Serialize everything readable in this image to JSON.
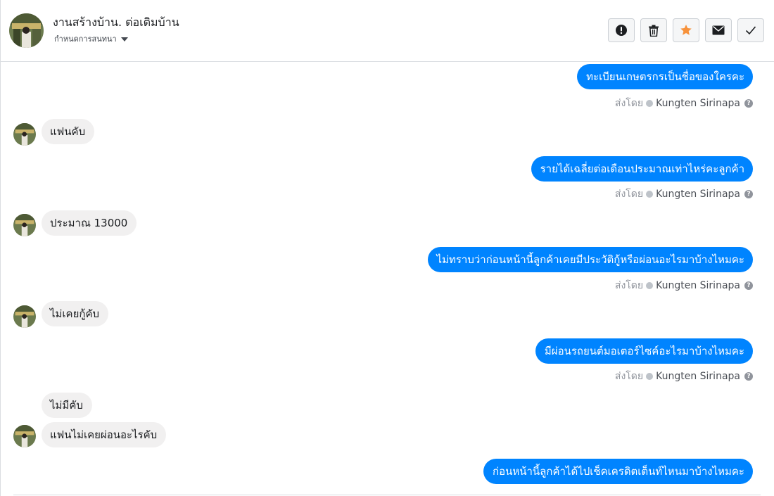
{
  "header": {
    "title": "งานสร้างบ้าน. ต่อเติมบ้าน",
    "subtitle": "กำหนดการสนทนา",
    "actions": [
      {
        "icon": "alert-icon",
        "name": "report-spam-button"
      },
      {
        "icon": "trash-icon",
        "name": "delete-button"
      },
      {
        "icon": "star-icon",
        "name": "star-button",
        "color": "#f7923b"
      },
      {
        "icon": "envelope-icon",
        "name": "mark-unread-button"
      },
      {
        "icon": "check-icon",
        "name": "mark-done-button"
      }
    ]
  },
  "messages": [
    {
      "dir": "out",
      "text": "ทะเบียนเกษตรกรเป็นชื่อของใครคะ"
    },
    {
      "dir": "in",
      "text": "แฟนคับ"
    },
    {
      "dir": "out",
      "text": "รายได้เฉลี่ยต่อเดือนประมาณเท่าไหร่คะลูกค้า"
    },
    {
      "dir": "in",
      "text": "ประมาณ   13000"
    },
    {
      "dir": "out",
      "text": "ไม่ทราบว่าก่อนหน้านี้ลูกค้าเคยมีประวัติกู้หรือผ่อนอะไรมาบ้างไหมคะ"
    },
    {
      "dir": "in",
      "text": "ไม่เคยกู้คับ"
    },
    {
      "dir": "out",
      "text": "มีผ่อนรถยนต์มอเตอร์ไซค์อะไรมาบ้างไหมคะ"
    },
    {
      "dir": "in",
      "text": "ไม่มีคับ"
    },
    {
      "dir": "in",
      "text": "แฟนไม่เคยผ่อนอะไรคับ"
    },
    {
      "dir": "out",
      "text": "ก่อนหน้านี้ลูกค้าได้ไปเช็คเครดิตเต็นท์ไหนมาบ้างไหมคะ"
    }
  ],
  "sender": {
    "prefix": "ส่งโดย",
    "name": "Kungten Sirinapa",
    "help": "?"
  },
  "colors": {
    "outgoing_bubble": "#0084ff",
    "incoming_bubble": "#f1f0f0",
    "star": "#f7923b"
  }
}
